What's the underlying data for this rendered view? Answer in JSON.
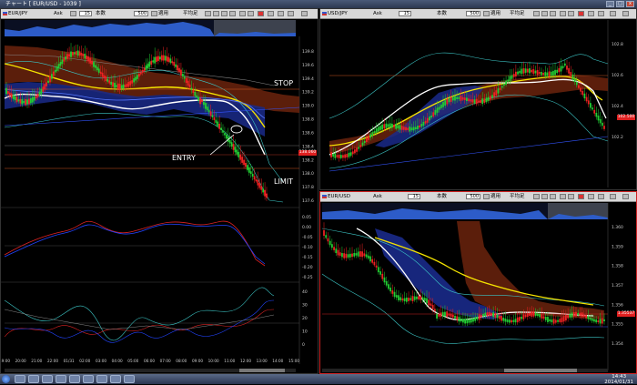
{
  "window": {
    "title": "チャート [ EUR/USD - 1039 ]",
    "min": "_",
    "max": "□",
    "close": "x"
  },
  "panes": [
    {
      "symbol": "EUR/JPY",
      "bid": "Ask",
      "count_label": "本数",
      "count": "500",
      "apply": "適用",
      "avg": "平均足"
    },
    {
      "symbol": "USD/JPY",
      "bid": "Ask",
      "count_label": "本数",
      "count": "500",
      "apply": "適用",
      "avg": "平均足"
    },
    {
      "symbol": "EUR/USD",
      "bid": "Ask",
      "count_label": "本数",
      "count": "500",
      "apply": "適用",
      "avg": "平均足"
    }
  ],
  "annotations": {
    "stop": "STOP",
    "entry": "ENTRY",
    "limit": "LIMIT"
  },
  "left_price_axis": [
    "139.8",
    "139.6",
    "139.4",
    "139.2",
    "139.0",
    "138.8",
    "138.6",
    "138.4",
    "138.2",
    "138.0",
    "137.8",
    "137.6"
  ],
  "left_price_badge": "138.060",
  "osc1_axis": [
    "0.05",
    "0.00",
    "-0.05",
    "-0.10",
    "-0.15",
    "-0.20",
    "-0.25"
  ],
  "osc2_axis": [
    "40",
    "30",
    "20",
    "10",
    "0"
  ],
  "time_axis": [
    "19:00",
    "20:00",
    "21:00",
    "22:00",
    "01/31",
    "02:00",
    "03:00",
    "04:00",
    "05:00",
    "06:00",
    "07:00",
    "08:00",
    "09:00",
    "10:00",
    "11:00",
    "12:00",
    "13:00",
    "14:00",
    "15:00"
  ],
  "usdjpy_axis": [
    "102.8",
    "102.6",
    "102.4",
    "102.2"
  ],
  "usdjpy_badge": "102.500",
  "eurusd_axis": [
    "1.360",
    "1.359",
    "1.358",
    "1.357",
    "1.356",
    "1.355",
    "1.354"
  ],
  "eurusd_badge": "1.35537",
  "taskbar": {
    "clock_time": "14:43",
    "clock_date": "2014/01/31"
  },
  "colors": {
    "up_candle": "#22cc33",
    "down_candle": "#ee2222",
    "cloud_red": "#7a2a12",
    "cloud_blue": "#15207a",
    "ma_white": "#ffffff",
    "ma_yellow": "#f5e400",
    "accent_red": "#cc2222"
  }
}
